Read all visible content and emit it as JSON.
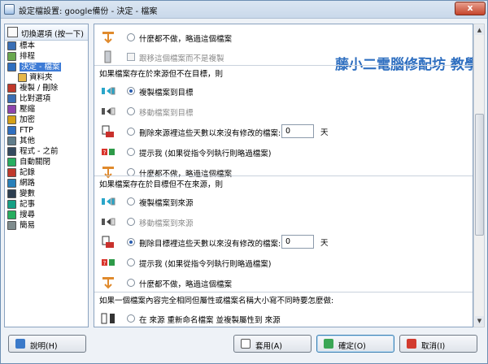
{
  "window": {
    "title": "設定檔設置: google備份 - 決定 - 檔案",
    "close_label": "x"
  },
  "sidebar": {
    "header": "切換選項 (按一下)",
    "items": [
      {
        "label": "標本",
        "icon": "target-icon",
        "color": "#3a6fb5"
      },
      {
        "label": "排程",
        "icon": "clock-icon",
        "color": "#6aa84f"
      },
      {
        "label": "決定 - 檔案",
        "icon": "grid-icon",
        "color": "#2f6fc0",
        "selected": true
      },
      {
        "label": "資料夾",
        "icon": "folder-icon",
        "color": "#e6b84a",
        "sub": true
      },
      {
        "label": "複製 / 刪除",
        "icon": "copy-icon",
        "color": "#c0392b"
      },
      {
        "label": "比對選項",
        "icon": "compare-icon",
        "color": "#3a6fb5"
      },
      {
        "label": "壓縮",
        "icon": "compress-icon",
        "color": "#8e44ad"
      },
      {
        "label": "加密",
        "icon": "lock-icon",
        "color": "#d4a017"
      },
      {
        "label": "FTP",
        "icon": "ftp-icon",
        "color": "#2f6fc0"
      },
      {
        "label": "其他",
        "icon": "gear-icon",
        "color": "#607d8b"
      },
      {
        "label": "程式 - 之前",
        "icon": "program-icon",
        "color": "#34495e"
      },
      {
        "label": "自動關閉",
        "icon": "power-icon",
        "color": "#27ae60"
      },
      {
        "label": "記錄",
        "icon": "log-icon",
        "color": "#c0392b"
      },
      {
        "label": "網路",
        "icon": "network-icon",
        "color": "#2980b9"
      },
      {
        "label": "變數",
        "icon": "variable-icon",
        "color": "#2c3e50"
      },
      {
        "label": "記事",
        "icon": "note-icon",
        "color": "#16a085"
      },
      {
        "label": "搜尋",
        "icon": "search-icon",
        "color": "#27ae60"
      },
      {
        "label": "簡易",
        "icon": "simple-icon",
        "color": "#7f8c8d"
      }
    ]
  },
  "content": {
    "top": {
      "do_nothing_label": "什麼都不做，略過這個檔案",
      "ignore_label": "跟移這個檔案而不是複製"
    },
    "section1": {
      "heading": "如果檔案存在於來源但不在目標，則",
      "options": [
        {
          "label": "複製檔案到目標",
          "checked": true,
          "disabled": false,
          "icon": "copy-to-dest-icon"
        },
        {
          "label": "移動檔案到目標",
          "checked": false,
          "disabled": true,
          "icon": "move-to-dest-icon"
        },
        {
          "label": "刪除來源裡這些天數以來沒有修改的檔案:",
          "checked": false,
          "disabled": false,
          "icon": "delete-source-icon",
          "days": "0",
          "unit": "天"
        },
        {
          "label": "提示我 (如果從指令列執行則略過檔案)",
          "checked": false,
          "disabled": false,
          "icon": "prompt-icon"
        },
        {
          "label": "什麼都不做，略過這個檔案",
          "checked": false,
          "disabled": false,
          "icon": "skip-icon"
        }
      ]
    },
    "section2": {
      "heading": "如果檔案存在於目標但不在來源，則",
      "options": [
        {
          "label": "複製檔案到來源",
          "checked": false,
          "disabled": false,
          "icon": "copy-to-source-icon"
        },
        {
          "label": "移動檔案到來源",
          "checked": false,
          "disabled": true,
          "icon": "move-to-source-icon"
        },
        {
          "label": "刪除目標裡這些天數以來沒有修改的檔案:",
          "checked": true,
          "disabled": false,
          "icon": "delete-dest-icon",
          "days": "0",
          "unit": "天"
        },
        {
          "label": "提示我 (如果從指令列執行則略過檔案)",
          "checked": false,
          "disabled": false,
          "icon": "prompt-icon"
        },
        {
          "label": "什麼都不做，略過這個檔案",
          "checked": false,
          "disabled": false,
          "icon": "skip-icon"
        }
      ]
    },
    "section3": {
      "heading": "如果一個檔案內容完全相同但屬性或檔案名稱大小寫不同時要怎麼做:",
      "option_label": "在 來源 重新命名檔案 並複製屬性到 來源"
    },
    "watermark": "藤小二電腦修配坊 教學圖"
  },
  "buttons": {
    "help": "說明(H)",
    "apply": "套用(A)",
    "ok": "確定(O)",
    "cancel": "取消(I)"
  }
}
